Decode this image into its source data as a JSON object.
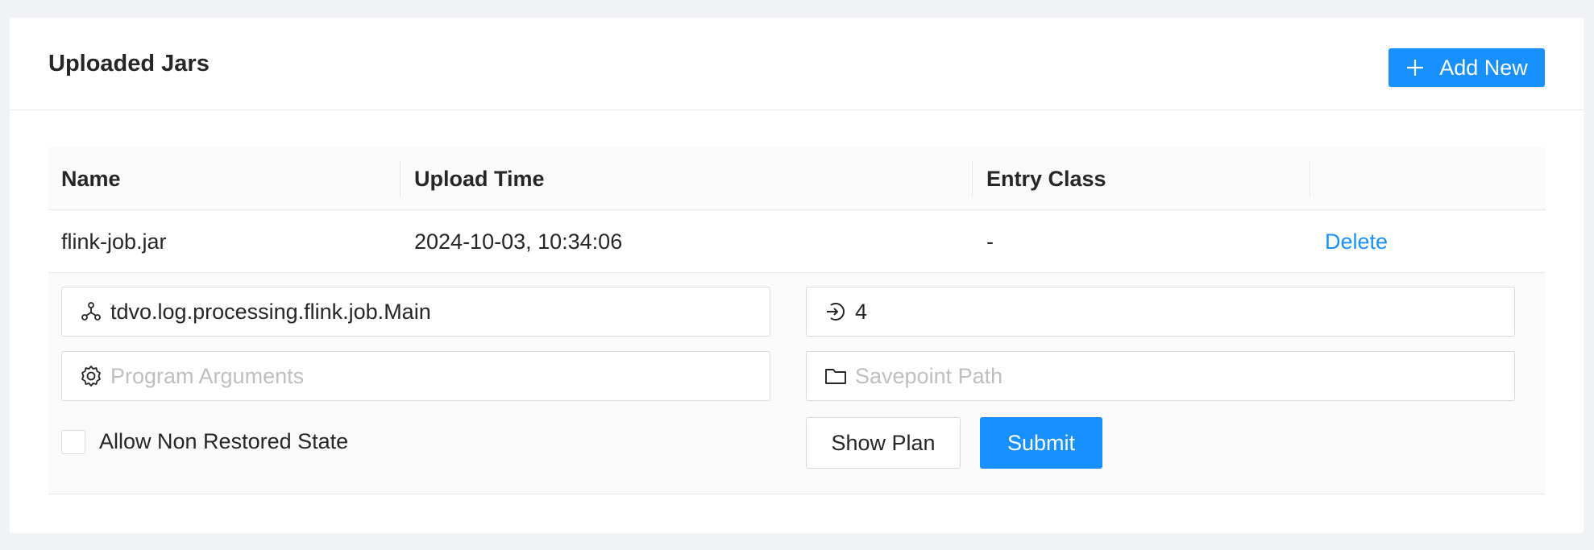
{
  "card": {
    "title": "Uploaded Jars",
    "add_button_label": "Add New"
  },
  "table": {
    "columns": [
      "Name",
      "Upload Time",
      "Entry Class",
      ""
    ],
    "rows": [
      {
        "name": "flink-job.jar",
        "upload_time": "2024-10-03, 10:34:06",
        "entry_class": "-",
        "action": "Delete"
      }
    ]
  },
  "submit_form": {
    "entry_class_value": "tdvo.log.processing.flink.job.Main",
    "parallelism_value": "4",
    "program_args_placeholder": "Program Arguments",
    "savepoint_placeholder": "Savepoint Path",
    "allow_non_restored_label": "Allow Non Restored State",
    "allow_non_restored_checked": false,
    "show_plan_label": "Show Plan",
    "submit_label": "Submit"
  },
  "colors": {
    "primary": "#1890ff",
    "background": "#f0f2f5",
    "header_bg": "#fafafa",
    "border": "#d9d9d9"
  },
  "icons": {
    "add": "plus-icon",
    "entry_class": "cluster-icon",
    "parallelism": "login-icon",
    "program_args": "gear-icon",
    "savepoint": "folder-icon"
  }
}
